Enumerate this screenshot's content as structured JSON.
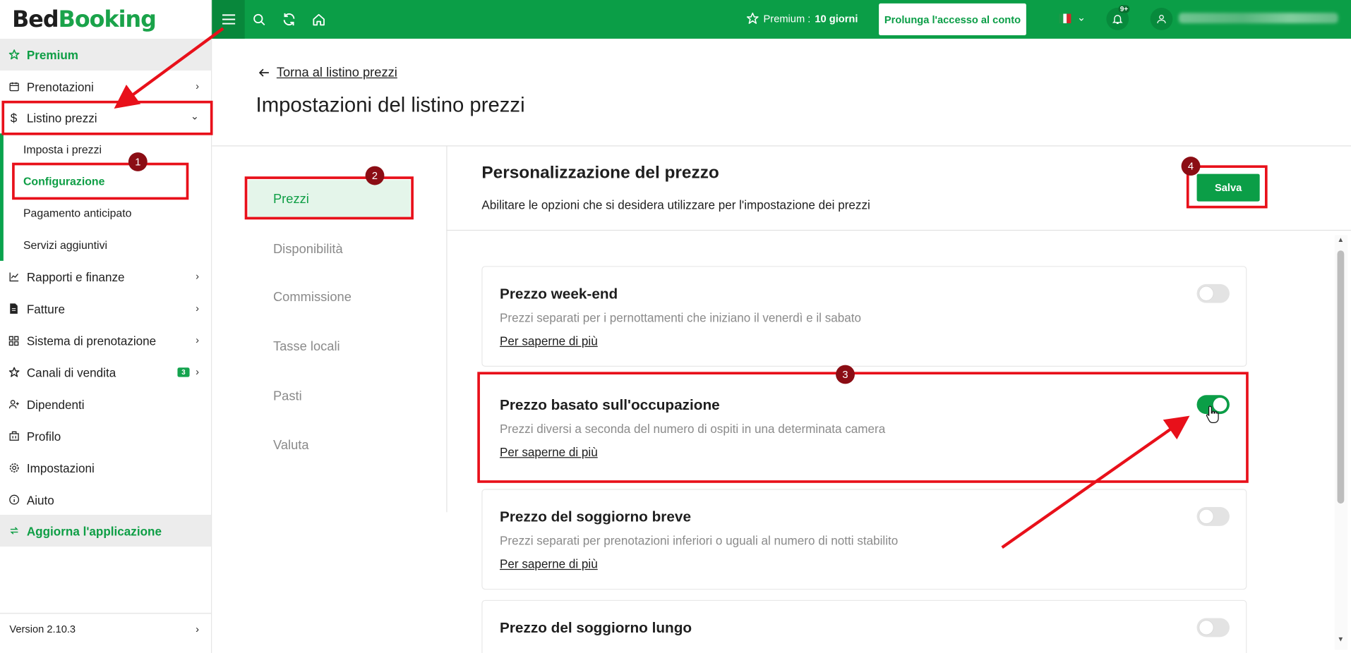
{
  "brand": {
    "part1": "Bed",
    "part2": "Booking"
  },
  "sidebar": {
    "premium": "Premium",
    "items": [
      {
        "label": "Prenotazioni"
      },
      {
        "label": "Listino prezzi"
      },
      {
        "label": "Rapporti e finanze"
      },
      {
        "label": "Fatture"
      },
      {
        "label": "Sistema di prenotazione"
      },
      {
        "label": "Canali di vendita",
        "badge": "3"
      },
      {
        "label": "Dipendenti"
      },
      {
        "label": "Profilo"
      },
      {
        "label": "Impostazioni"
      },
      {
        "label": "Aiuto"
      }
    ],
    "subitems": [
      {
        "label": "Imposta i prezzi"
      },
      {
        "label": "Configurazione"
      },
      {
        "label": "Pagamento anticipato"
      },
      {
        "label": "Servizi aggiuntivi"
      }
    ],
    "update_app": "Aggiorna l'applicazione",
    "version": "Version 2.10.3"
  },
  "topbar": {
    "premium_label": "Premium :",
    "premium_days": "10 giorni",
    "extend_button": "Prolunga l'accesso al conto",
    "notifications_badge": "9+"
  },
  "page": {
    "back_link": "Torna al listino prezzi",
    "title": "Impostazioni del listino prezzi",
    "tabs": [
      {
        "label": "Prezzi"
      },
      {
        "label": "Disponibilità"
      },
      {
        "label": "Commissione"
      },
      {
        "label": "Tasse locali"
      },
      {
        "label": "Pasti"
      },
      {
        "label": "Valuta"
      }
    ],
    "section_title": "Personalizzazione del prezzo",
    "section_subtitle": "Abilitare le opzioni che si desidera utilizzare per l'impostazione dei prezzi",
    "save_button": "Salva",
    "cards": [
      {
        "title": "Prezzo week-end",
        "desc": "Prezzi separati per i pernottamenti che iniziano il venerdì e il sabato",
        "link": "Per saperne di più",
        "enabled": false
      },
      {
        "title": "Prezzo basato sull'occupazione",
        "desc": "Prezzi diversi a seconda del numero di ospiti in una determinata camera",
        "link": "Per saperne di più",
        "enabled": true
      },
      {
        "title": "Prezzo del soggiorno breve",
        "desc": "Prezzi separati per prenotazioni inferiori o uguali al numero di notti stabilito",
        "link": "Per saperne di più",
        "enabled": false
      },
      {
        "title": "Prezzo del soggiorno lungo",
        "desc": "",
        "link": "",
        "enabled": false
      }
    ]
  },
  "annotations": {
    "markers": [
      "1",
      "2",
      "3",
      "4"
    ]
  },
  "colors": {
    "brand_green": "#0b9e47",
    "annotation_red": "#e8101a",
    "marker_dark_red": "#8b0d14"
  }
}
